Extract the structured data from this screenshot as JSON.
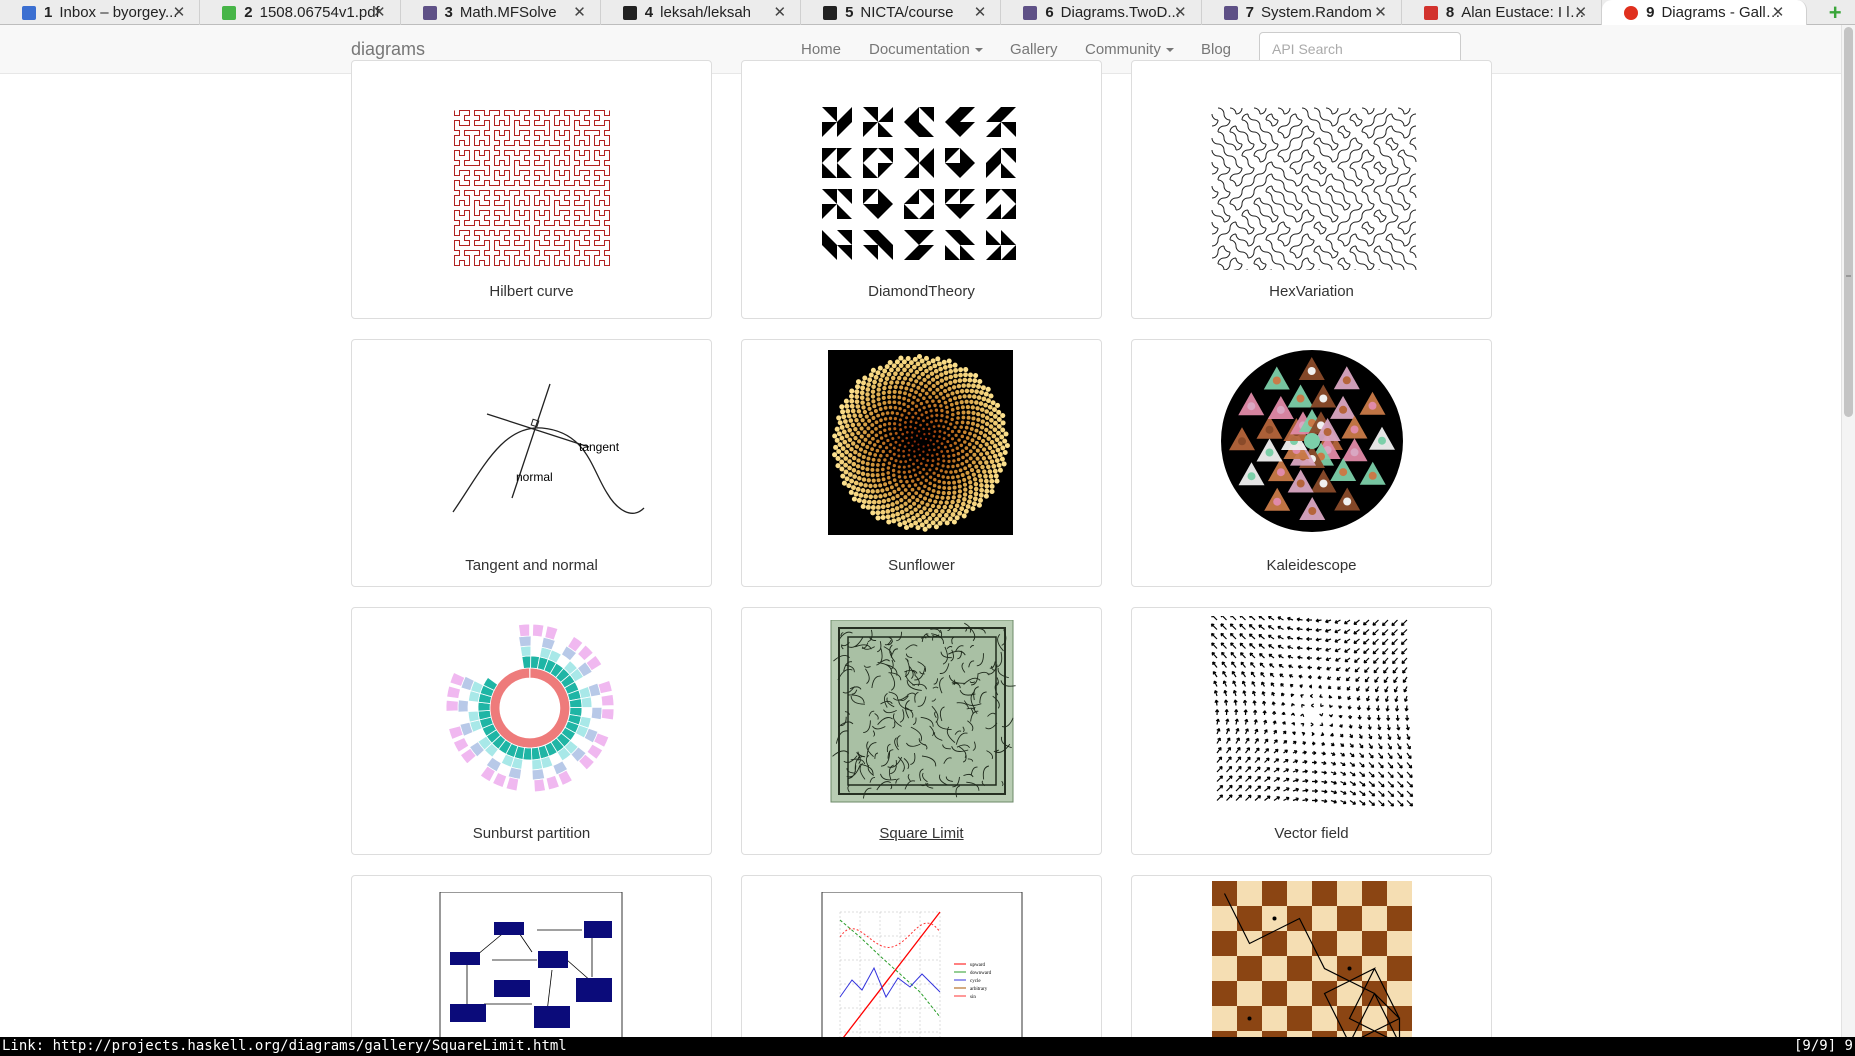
{
  "browser": {
    "tabs": [
      {
        "num": "1",
        "label": "Inbox – byorgey...",
        "icon_color": "#3b6fd1"
      },
      {
        "num": "2",
        "label": "1508.06754v1.pdf",
        "icon_color": "#47b548"
      },
      {
        "num": "3",
        "label": "Math.MFSolve",
        "icon_color": "#5e5086"
      },
      {
        "num": "4",
        "label": "leksah/leksah",
        "icon_color": "#222222"
      },
      {
        "num": "5",
        "label": "NICTA/course",
        "icon_color": "#222222"
      },
      {
        "num": "6",
        "label": "Diagrams.TwoD...",
        "icon_color": "#5e5086"
      },
      {
        "num": "7",
        "label": "System.Random",
        "icon_color": "#5e5086"
      },
      {
        "num": "8",
        "label": "Alan Eustace: I le...",
        "icon_color": "#d2322d"
      },
      {
        "num": "9",
        "label": "Diagrams - Gallery",
        "icon_color": "#e0301e"
      }
    ],
    "close_glyph": "✕",
    "add_glyph": "+"
  },
  "nav": {
    "brand": "diagrams",
    "links": {
      "home": "Home",
      "documentation": "Documentation",
      "gallery": "Gallery",
      "community": "Community",
      "blog": "Blog"
    },
    "search_placeholder": "API Search"
  },
  "gallery": {
    "items": [
      {
        "caption": "Hilbert curve"
      },
      {
        "caption": "DiamondTheory"
      },
      {
        "caption": "HexVariation"
      },
      {
        "caption": "Tangent and normal",
        "labels": {
          "tangent": "tangent",
          "normal": "normal"
        }
      },
      {
        "caption": "Sunflower"
      },
      {
        "caption": "Kaleidescope"
      },
      {
        "caption": "Sunburst partition"
      },
      {
        "caption": "Square Limit"
      },
      {
        "caption": "Vector field"
      },
      {
        "caption": ""
      },
      {
        "caption": "",
        "legend": [
          "upward",
          "downward",
          "cycle",
          "arbitrary",
          "sin"
        ]
      },
      {
        "caption": ""
      }
    ]
  },
  "statusbar": {
    "text": "Link: http://projects.haskell.org/diagrams/gallery/SquareLimit.html",
    "right": "[9/9] 9"
  }
}
